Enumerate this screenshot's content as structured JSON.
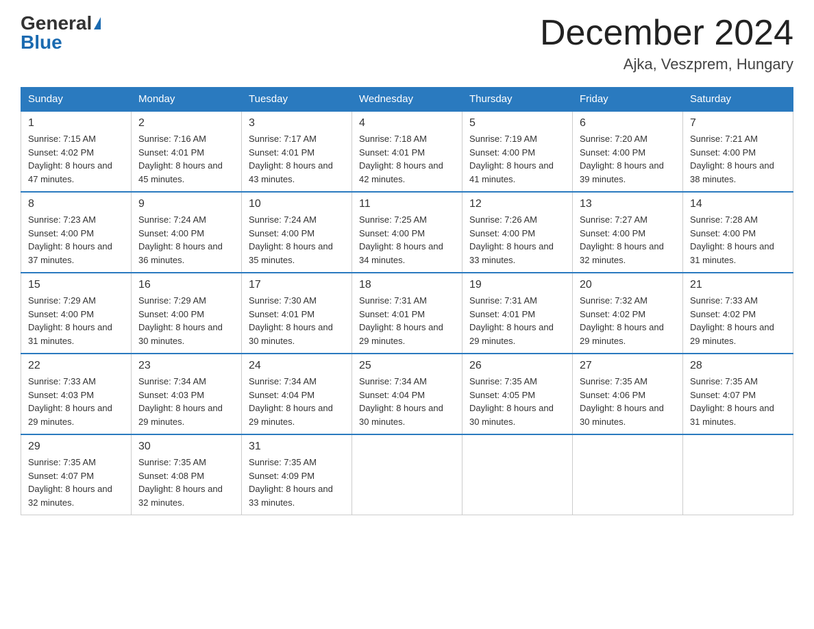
{
  "header": {
    "logo_general": "General",
    "logo_blue": "Blue",
    "month_title": "December 2024",
    "location": "Ajka, Veszprem, Hungary"
  },
  "days_of_week": [
    "Sunday",
    "Monday",
    "Tuesday",
    "Wednesday",
    "Thursday",
    "Friday",
    "Saturday"
  ],
  "weeks": [
    [
      {
        "day": "1",
        "sunrise": "7:15 AM",
        "sunset": "4:02 PM",
        "daylight": "8 hours and 47 minutes."
      },
      {
        "day": "2",
        "sunrise": "7:16 AM",
        "sunset": "4:01 PM",
        "daylight": "8 hours and 45 minutes."
      },
      {
        "day": "3",
        "sunrise": "7:17 AM",
        "sunset": "4:01 PM",
        "daylight": "8 hours and 43 minutes."
      },
      {
        "day": "4",
        "sunrise": "7:18 AM",
        "sunset": "4:01 PM",
        "daylight": "8 hours and 42 minutes."
      },
      {
        "day": "5",
        "sunrise": "7:19 AM",
        "sunset": "4:00 PM",
        "daylight": "8 hours and 41 minutes."
      },
      {
        "day": "6",
        "sunrise": "7:20 AM",
        "sunset": "4:00 PM",
        "daylight": "8 hours and 39 minutes."
      },
      {
        "day": "7",
        "sunrise": "7:21 AM",
        "sunset": "4:00 PM",
        "daylight": "8 hours and 38 minutes."
      }
    ],
    [
      {
        "day": "8",
        "sunrise": "7:23 AM",
        "sunset": "4:00 PM",
        "daylight": "8 hours and 37 minutes."
      },
      {
        "day": "9",
        "sunrise": "7:24 AM",
        "sunset": "4:00 PM",
        "daylight": "8 hours and 36 minutes."
      },
      {
        "day": "10",
        "sunrise": "7:24 AM",
        "sunset": "4:00 PM",
        "daylight": "8 hours and 35 minutes."
      },
      {
        "day": "11",
        "sunrise": "7:25 AM",
        "sunset": "4:00 PM",
        "daylight": "8 hours and 34 minutes."
      },
      {
        "day": "12",
        "sunrise": "7:26 AM",
        "sunset": "4:00 PM",
        "daylight": "8 hours and 33 minutes."
      },
      {
        "day": "13",
        "sunrise": "7:27 AM",
        "sunset": "4:00 PM",
        "daylight": "8 hours and 32 minutes."
      },
      {
        "day": "14",
        "sunrise": "7:28 AM",
        "sunset": "4:00 PM",
        "daylight": "8 hours and 31 minutes."
      }
    ],
    [
      {
        "day": "15",
        "sunrise": "7:29 AM",
        "sunset": "4:00 PM",
        "daylight": "8 hours and 31 minutes."
      },
      {
        "day": "16",
        "sunrise": "7:29 AM",
        "sunset": "4:00 PM",
        "daylight": "8 hours and 30 minutes."
      },
      {
        "day": "17",
        "sunrise": "7:30 AM",
        "sunset": "4:01 PM",
        "daylight": "8 hours and 30 minutes."
      },
      {
        "day": "18",
        "sunrise": "7:31 AM",
        "sunset": "4:01 PM",
        "daylight": "8 hours and 29 minutes."
      },
      {
        "day": "19",
        "sunrise": "7:31 AM",
        "sunset": "4:01 PM",
        "daylight": "8 hours and 29 minutes."
      },
      {
        "day": "20",
        "sunrise": "7:32 AM",
        "sunset": "4:02 PM",
        "daylight": "8 hours and 29 minutes."
      },
      {
        "day": "21",
        "sunrise": "7:33 AM",
        "sunset": "4:02 PM",
        "daylight": "8 hours and 29 minutes."
      }
    ],
    [
      {
        "day": "22",
        "sunrise": "7:33 AM",
        "sunset": "4:03 PM",
        "daylight": "8 hours and 29 minutes."
      },
      {
        "day": "23",
        "sunrise": "7:34 AM",
        "sunset": "4:03 PM",
        "daylight": "8 hours and 29 minutes."
      },
      {
        "day": "24",
        "sunrise": "7:34 AM",
        "sunset": "4:04 PM",
        "daylight": "8 hours and 29 minutes."
      },
      {
        "day": "25",
        "sunrise": "7:34 AM",
        "sunset": "4:04 PM",
        "daylight": "8 hours and 30 minutes."
      },
      {
        "day": "26",
        "sunrise": "7:35 AM",
        "sunset": "4:05 PM",
        "daylight": "8 hours and 30 minutes."
      },
      {
        "day": "27",
        "sunrise": "7:35 AM",
        "sunset": "4:06 PM",
        "daylight": "8 hours and 30 minutes."
      },
      {
        "day": "28",
        "sunrise": "7:35 AM",
        "sunset": "4:07 PM",
        "daylight": "8 hours and 31 minutes."
      }
    ],
    [
      {
        "day": "29",
        "sunrise": "7:35 AM",
        "sunset": "4:07 PM",
        "daylight": "8 hours and 32 minutes."
      },
      {
        "day": "30",
        "sunrise": "7:35 AM",
        "sunset": "4:08 PM",
        "daylight": "8 hours and 32 minutes."
      },
      {
        "day": "31",
        "sunrise": "7:35 AM",
        "sunset": "4:09 PM",
        "daylight": "8 hours and 33 minutes."
      },
      null,
      null,
      null,
      null
    ]
  ]
}
